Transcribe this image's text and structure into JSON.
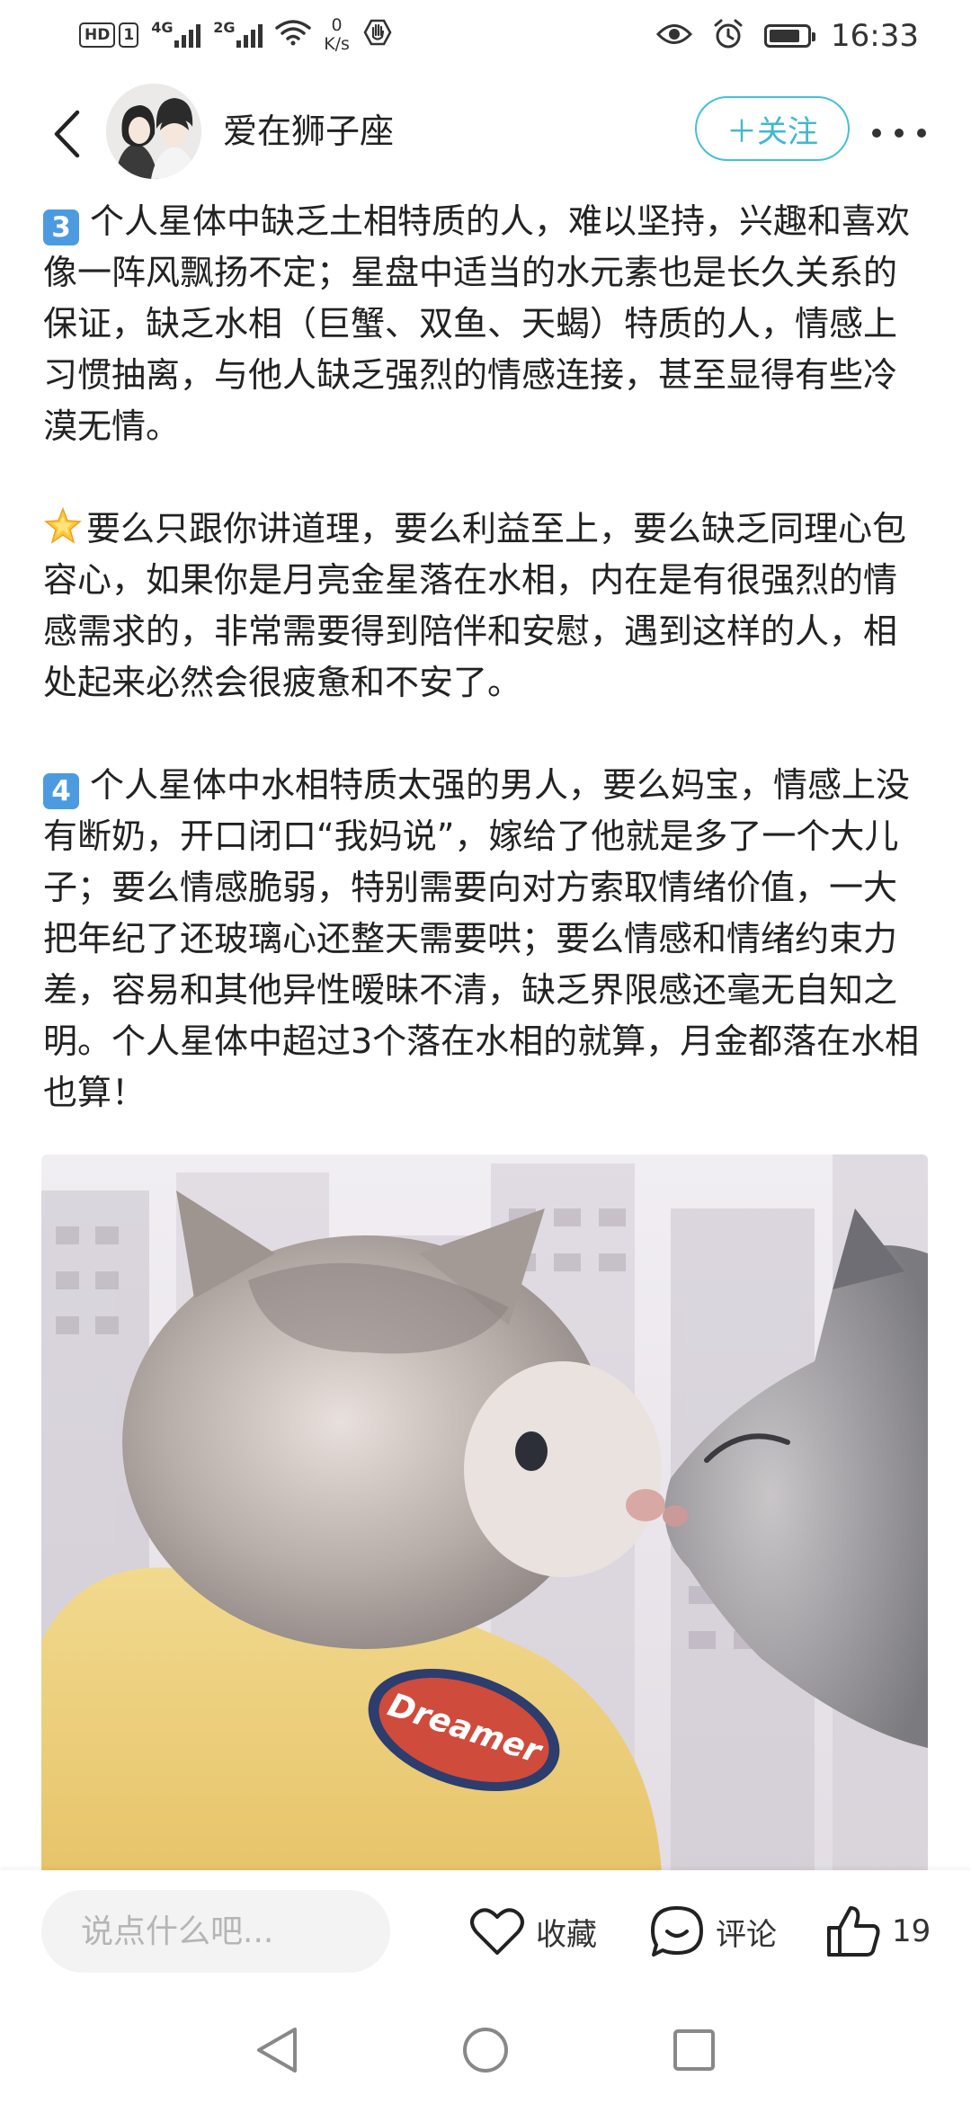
{
  "status_bar": {
    "hd_badge": "HD",
    "sim_badge": "1",
    "signal1_label": "4G",
    "signal2_label": "2G",
    "net_speed_value": "0",
    "net_speed_unit": "K/s",
    "time": "16:33",
    "icons": [
      "wifi-icon",
      "hand-icon",
      "eye-icon",
      "alarm-icon",
      "battery-icon"
    ]
  },
  "header": {
    "username": "爱在狮子座",
    "follow_label": "关注",
    "follow_plus": "＋"
  },
  "content": {
    "p1_badge": "3",
    "p1": "个人星体中缺乏土相特质的人，难以坚持，兴趣和喜欢像一阵风飘扬不定；星盘中适当的水元素也是长久关系的保证，缺乏水相（巨蟹、双鱼、天蝎）特质的人，情感上习惯抽离，与他人缺乏强烈的情感连接，甚至显得有些冷漠无情。",
    "p2": "要么只跟你讲道理，要么利益至上，要么缺乏同理心包容心，如果你是月亮金星落在水相，内在是有很强烈的情感需求的，非常需要得到陪伴和安慰，遇到这样的人，相处起来必然会很疲惫和不安了。",
    "p3_badge": "4",
    "p3": "个人星体中水相特质太强的男人，要么妈宝，情感上没有断奶，开口闭口“我妈说”，嫁给了他就是多了一个大儿子；要么情感脆弱，特别需要向对方索取情绪价值，一大把年纪了还玻璃心还整天需要哄；要么情感和情绪约束力差，容易和其他异性暧昧不清，缺乏界限感还毫无自知之明。个人星体中超过3个落在水相的就算，月金都落在水相也算！",
    "photo_shirt_text": "Dreamer"
  },
  "bottom_bar": {
    "comment_placeholder": "说点什么吧...",
    "favorite_label": "收藏",
    "comment_label": "评论",
    "like_count": "19"
  },
  "colors": {
    "accent": "#3fb9cc",
    "keycap": "#4c9be0",
    "text": "#222222"
  }
}
